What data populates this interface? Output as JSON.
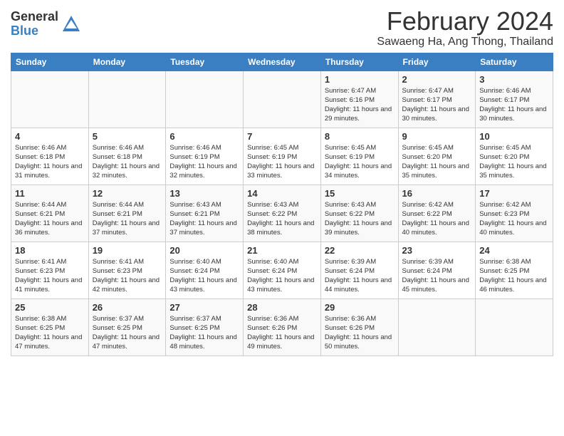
{
  "header": {
    "logo_general": "General",
    "logo_blue": "Blue",
    "title": "February 2024",
    "subtitle": "Sawaeng Ha, Ang Thong, Thailand"
  },
  "weekdays": [
    "Sunday",
    "Monday",
    "Tuesday",
    "Wednesday",
    "Thursday",
    "Friday",
    "Saturday"
  ],
  "weeks": [
    [
      {
        "day": "",
        "info": ""
      },
      {
        "day": "",
        "info": ""
      },
      {
        "day": "",
        "info": ""
      },
      {
        "day": "",
        "info": ""
      },
      {
        "day": "1",
        "info": "Sunrise: 6:47 AM\nSunset: 6:16 PM\nDaylight: 11 hours and 29 minutes."
      },
      {
        "day": "2",
        "info": "Sunrise: 6:47 AM\nSunset: 6:17 PM\nDaylight: 11 hours and 30 minutes."
      },
      {
        "day": "3",
        "info": "Sunrise: 6:46 AM\nSunset: 6:17 PM\nDaylight: 11 hours and 30 minutes."
      }
    ],
    [
      {
        "day": "4",
        "info": "Sunrise: 6:46 AM\nSunset: 6:18 PM\nDaylight: 11 hours and 31 minutes."
      },
      {
        "day": "5",
        "info": "Sunrise: 6:46 AM\nSunset: 6:18 PM\nDaylight: 11 hours and 32 minutes."
      },
      {
        "day": "6",
        "info": "Sunrise: 6:46 AM\nSunset: 6:19 PM\nDaylight: 11 hours and 32 minutes."
      },
      {
        "day": "7",
        "info": "Sunrise: 6:45 AM\nSunset: 6:19 PM\nDaylight: 11 hours and 33 minutes."
      },
      {
        "day": "8",
        "info": "Sunrise: 6:45 AM\nSunset: 6:19 PM\nDaylight: 11 hours and 34 minutes."
      },
      {
        "day": "9",
        "info": "Sunrise: 6:45 AM\nSunset: 6:20 PM\nDaylight: 11 hours and 35 minutes."
      },
      {
        "day": "10",
        "info": "Sunrise: 6:45 AM\nSunset: 6:20 PM\nDaylight: 11 hours and 35 minutes."
      }
    ],
    [
      {
        "day": "11",
        "info": "Sunrise: 6:44 AM\nSunset: 6:21 PM\nDaylight: 11 hours and 36 minutes."
      },
      {
        "day": "12",
        "info": "Sunrise: 6:44 AM\nSunset: 6:21 PM\nDaylight: 11 hours and 37 minutes."
      },
      {
        "day": "13",
        "info": "Sunrise: 6:43 AM\nSunset: 6:21 PM\nDaylight: 11 hours and 37 minutes."
      },
      {
        "day": "14",
        "info": "Sunrise: 6:43 AM\nSunset: 6:22 PM\nDaylight: 11 hours and 38 minutes."
      },
      {
        "day": "15",
        "info": "Sunrise: 6:43 AM\nSunset: 6:22 PM\nDaylight: 11 hours and 39 minutes."
      },
      {
        "day": "16",
        "info": "Sunrise: 6:42 AM\nSunset: 6:22 PM\nDaylight: 11 hours and 40 minutes."
      },
      {
        "day": "17",
        "info": "Sunrise: 6:42 AM\nSunset: 6:23 PM\nDaylight: 11 hours and 40 minutes."
      }
    ],
    [
      {
        "day": "18",
        "info": "Sunrise: 6:41 AM\nSunset: 6:23 PM\nDaylight: 11 hours and 41 minutes."
      },
      {
        "day": "19",
        "info": "Sunrise: 6:41 AM\nSunset: 6:23 PM\nDaylight: 11 hours and 42 minutes."
      },
      {
        "day": "20",
        "info": "Sunrise: 6:40 AM\nSunset: 6:24 PM\nDaylight: 11 hours and 43 minutes."
      },
      {
        "day": "21",
        "info": "Sunrise: 6:40 AM\nSunset: 6:24 PM\nDaylight: 11 hours and 43 minutes."
      },
      {
        "day": "22",
        "info": "Sunrise: 6:39 AM\nSunset: 6:24 PM\nDaylight: 11 hours and 44 minutes."
      },
      {
        "day": "23",
        "info": "Sunrise: 6:39 AM\nSunset: 6:24 PM\nDaylight: 11 hours and 45 minutes."
      },
      {
        "day": "24",
        "info": "Sunrise: 6:38 AM\nSunset: 6:25 PM\nDaylight: 11 hours and 46 minutes."
      }
    ],
    [
      {
        "day": "25",
        "info": "Sunrise: 6:38 AM\nSunset: 6:25 PM\nDaylight: 11 hours and 47 minutes."
      },
      {
        "day": "26",
        "info": "Sunrise: 6:37 AM\nSunset: 6:25 PM\nDaylight: 11 hours and 47 minutes."
      },
      {
        "day": "27",
        "info": "Sunrise: 6:37 AM\nSunset: 6:25 PM\nDaylight: 11 hours and 48 minutes."
      },
      {
        "day": "28",
        "info": "Sunrise: 6:36 AM\nSunset: 6:26 PM\nDaylight: 11 hours and 49 minutes."
      },
      {
        "day": "29",
        "info": "Sunrise: 6:36 AM\nSunset: 6:26 PM\nDaylight: 11 hours and 50 minutes."
      },
      {
        "day": "",
        "info": ""
      },
      {
        "day": "",
        "info": ""
      }
    ]
  ]
}
